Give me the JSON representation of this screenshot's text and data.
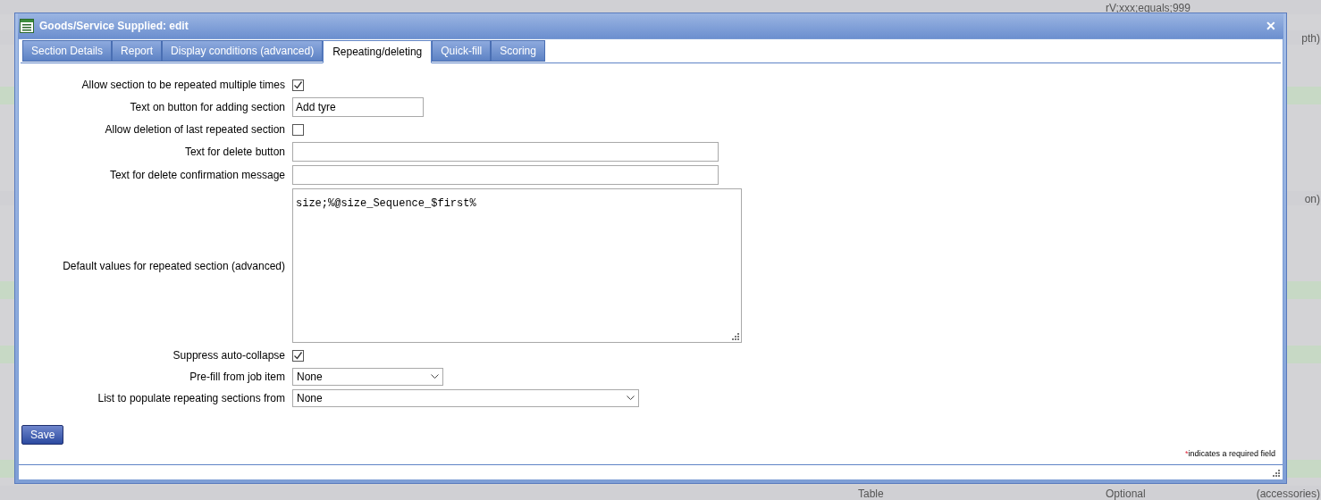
{
  "background_rows": [
    {
      "col_3": "rV;xxx;equals;999"
    },
    {
      "col_4": "pth)"
    },
    {
      "col_4": "on)"
    },
    {
      "middle": "Table",
      "col_3": "Optional",
      "col_4": "(accessories)"
    }
  ],
  "dialog": {
    "title": "Goods/Service Supplied: edit",
    "close": "✕"
  },
  "tabs": [
    {
      "label": "Section Details",
      "selected": false
    },
    {
      "label": "Report",
      "selected": false
    },
    {
      "label": "Display conditions (advanced)",
      "selected": false
    },
    {
      "label": "Repeating/deleting",
      "selected": true
    },
    {
      "label": "Quick-fill",
      "selected": false
    },
    {
      "label": "Scoring",
      "selected": false
    }
  ],
  "fields": [
    {
      "label": "Allow section to be repeated multiple times",
      "kind": "checkbox",
      "checked": true
    },
    {
      "label": "Text on button for adding section",
      "kind": "text",
      "value": "Add tyre"
    },
    {
      "label": "Allow deletion of last repeated section",
      "kind": "checkbox",
      "checked": false
    },
    {
      "label": "Text for delete button",
      "kind": "text"
    },
    {
      "label": "Text for delete confirmation message",
      "kind": "text"
    },
    {
      "label": "Default values for repeated section (advanced)",
      "kind": "textarea",
      "value": "size;%@size_Sequence_$first%"
    },
    {
      "label": "Suppress auto-collapse",
      "kind": "checkbox",
      "checked": true
    },
    {
      "label": "Pre-fill from job item",
      "kind": "select",
      "value": "None"
    },
    {
      "label": "List to populate repeating sections from",
      "kind": "select",
      "value": "None"
    }
  ],
  "save_button": "Save",
  "required_note": {
    "mark": "*",
    "text": "indicates a required field"
  }
}
